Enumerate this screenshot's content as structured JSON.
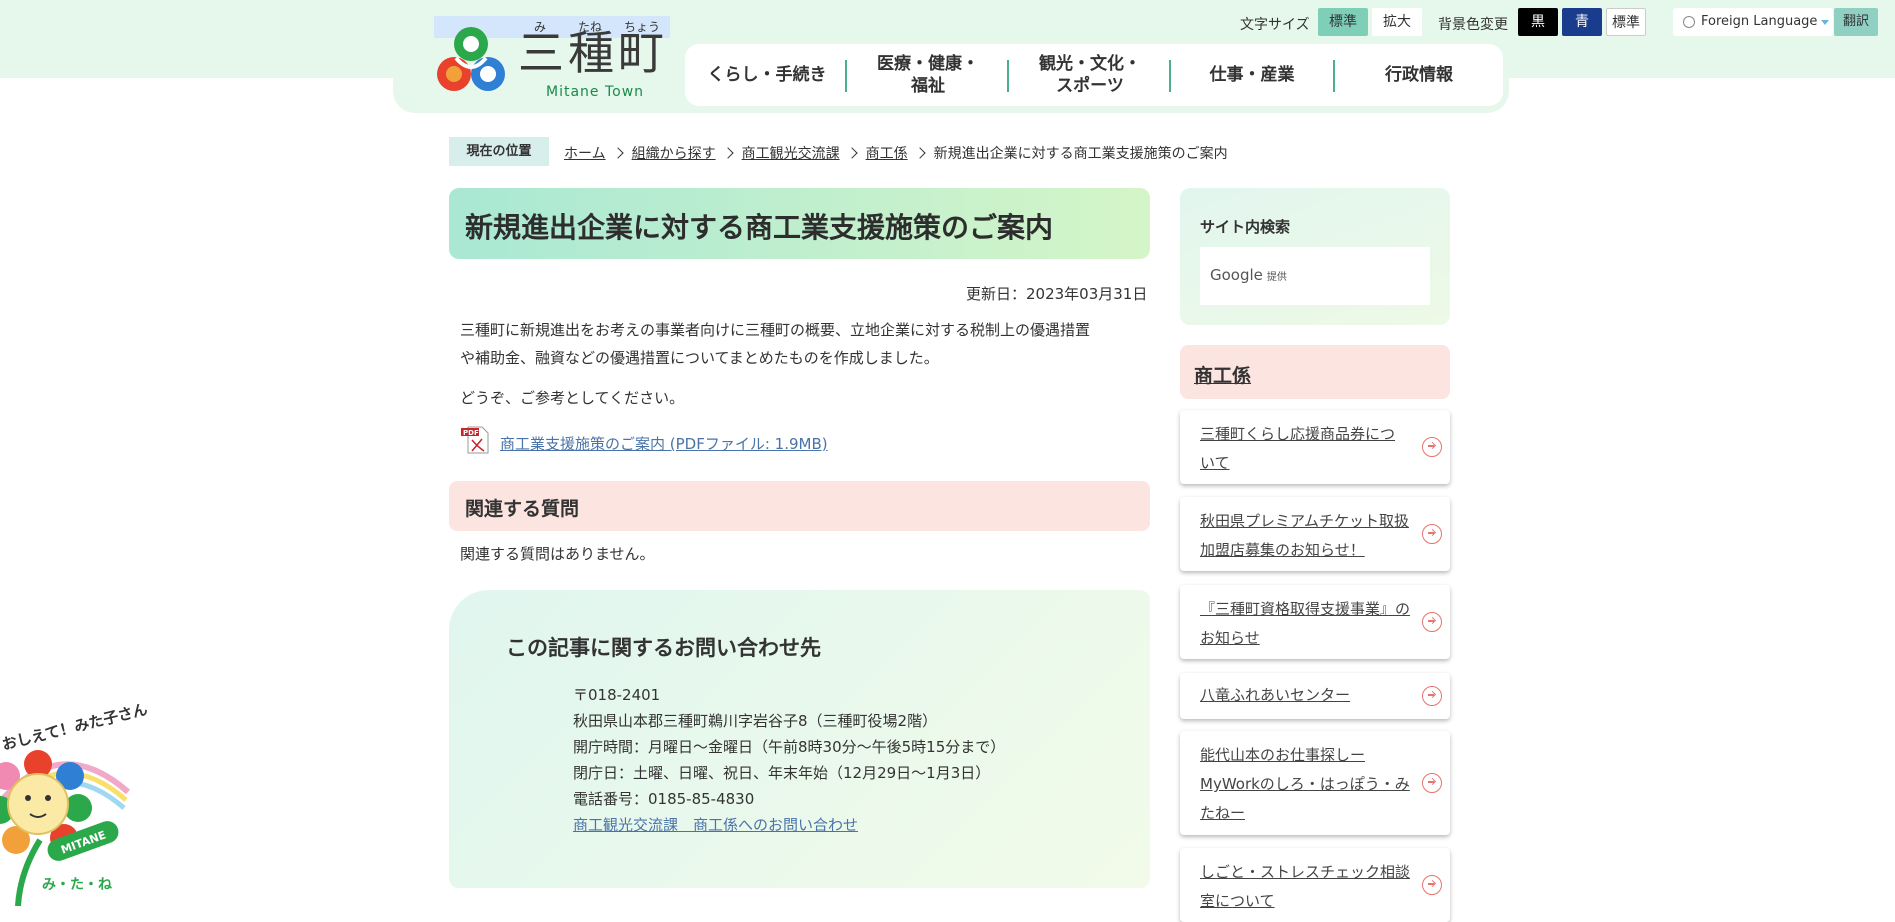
{
  "header": {
    "logo": {
      "ruby": [
        "み",
        "たね",
        "ちょう"
      ],
      "name": "三種町",
      "english": "Mitane Town"
    },
    "font_size_label": "文字サイズ",
    "font_size_options": [
      "標準",
      "拡大"
    ],
    "bg_color_label": "背景色変更",
    "bg_color_options": [
      "黒",
      "青",
      "標準"
    ],
    "language_label": "Foreign Language",
    "translate_label": "翻訳",
    "nav": [
      "くらし・手続き",
      "医療・健康・\n福祉",
      "観光・文化・\nスポーツ",
      "仕事・産業",
      "行政情報"
    ]
  },
  "breadcrumb": {
    "label": "現在の位置",
    "items": [
      "ホーム",
      "組織から探す",
      "商工観光交流課",
      "商工係"
    ],
    "current": "新規進出企業に対する商工業支援施策のご案内"
  },
  "article": {
    "title": "新規進出企業に対する商工業支援施策のご案内",
    "updated": "更新日：2023年03月31日",
    "paragraph1_line1": "三種町に新規進出をお考えの事業者向けに三種町の概要、立地企業に対する税制上の優遇措置",
    "paragraph1_line2": "や補助金、融資などの優遇措置についてまとめたものを作成しました。",
    "paragraph2": "どうぞ、ご参考としてください。",
    "pdf_link": "商工業支援施策のご案内 (PDFファイル: 1.9MB)",
    "related_heading": "関連する質問",
    "related_none": "関連する質問はありません。"
  },
  "contact": {
    "title": "この記事に関するお問い合わせ先",
    "postal": "〒018-2401",
    "address": "秋田県山本郡三種町鵜川字岩谷子8（三種町役場2階）",
    "hours": "開庁時間：月曜日～金曜日（午前8時30分～午後5時15分まで）",
    "closed": "閉庁日：土曜、日曜、祝日、年末年始（12月29日～1月3日）",
    "phone": "電話番号：0185-85-4830",
    "link": "商工観光交流課　商工係へのお問い合わせ"
  },
  "sidebar": {
    "search_title": "サイト内検索",
    "search_brand": "Google",
    "search_brand_suffix": "提供",
    "section_heading": "商工係",
    "links": [
      "三種町くらし応援商品券について",
      "秋田県プレミアムチケット取扱加盟店募集のお知らせ！",
      "『三種町資格取得支援事業』のお知らせ",
      "八竜ふれあいセンター",
      "能代山本のお仕事探しーMyWorkのしろ・はっぽう・みたねー",
      "しごと・ストレスチェック相談室について"
    ]
  },
  "mascot": {
    "caption_top": "おしえて！みた子さん",
    "badge": "MITANE",
    "caption_bottom": "み・た・ね"
  },
  "colors": {
    "header_bg": "#e6f7ec",
    "nav_separator": "#4bb08a",
    "active_btn": "#7fcfb8",
    "black_btn": "#000000",
    "blue_btn": "#1a3c8c",
    "link_blue": "#4a73a8",
    "pink_heading": "#fce5e1",
    "arrow": "#e8736d"
  }
}
